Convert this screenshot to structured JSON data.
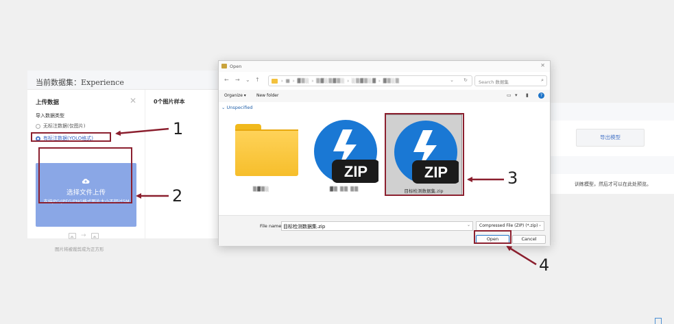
{
  "app": {
    "dataset_title": "当前数据集：Experience",
    "upload_panel": {
      "title": "上传数据",
      "close": "✕",
      "import_type_label": "导入数据类型",
      "options": [
        {
          "label": "无标注数据(仅图片)",
          "selected": false
        },
        {
          "label": "有标注数据(YOLO格式)",
          "selected": true
        }
      ],
      "upload_button": "选择文件上传",
      "upload_hint": "支持JPG/JPEG/PNG格式图片大小不超过5M",
      "crop_note": "图片将被裁剪成为正方形"
    },
    "samples_title": "0个图片样本",
    "export_button": "导出模型",
    "right_text": "训练模型，然后才可以在此处预览。"
  },
  "dialog": {
    "title": "Open",
    "close": "✕",
    "nav": {
      "back": "←",
      "forward": "→",
      "down": "⌄",
      "up": "↑"
    },
    "address": "› ▦ › ▓▒░ › ▒▓░▒▓▒░ › ░▒▓▒░▓ › ▓▒░▒",
    "address_chevron": "⌄",
    "refresh": "↻",
    "search_placeholder": "Search 数据集",
    "search_icon": "⌕",
    "organize": "Organize ▾",
    "new_folder": "New folder",
    "view_icons": [
      "▭",
      "▾",
      "▮"
    ],
    "help": "?",
    "group": "⌄ Unspecified",
    "files": [
      {
        "name": "▒▓▒░",
        "type": "folder",
        "selected": false
      },
      {
        "name": "▓▒ ▒▒ ▒▒",
        "type": "zip",
        "selected": false
      },
      {
        "name": "目标检测数据集.zip",
        "type": "zip",
        "selected": true
      }
    ],
    "zip_label": "ZIP",
    "file_name_label": "File name:",
    "file_name_value": "目标检测数据集.zip",
    "file_type": "Compressed File (ZIP) (*.zip)",
    "open_button": "Open",
    "cancel_button": "Cancel"
  },
  "annotations": {
    "steps": [
      "1",
      "2",
      "3",
      "4"
    ],
    "color": "#8b1f2e"
  }
}
